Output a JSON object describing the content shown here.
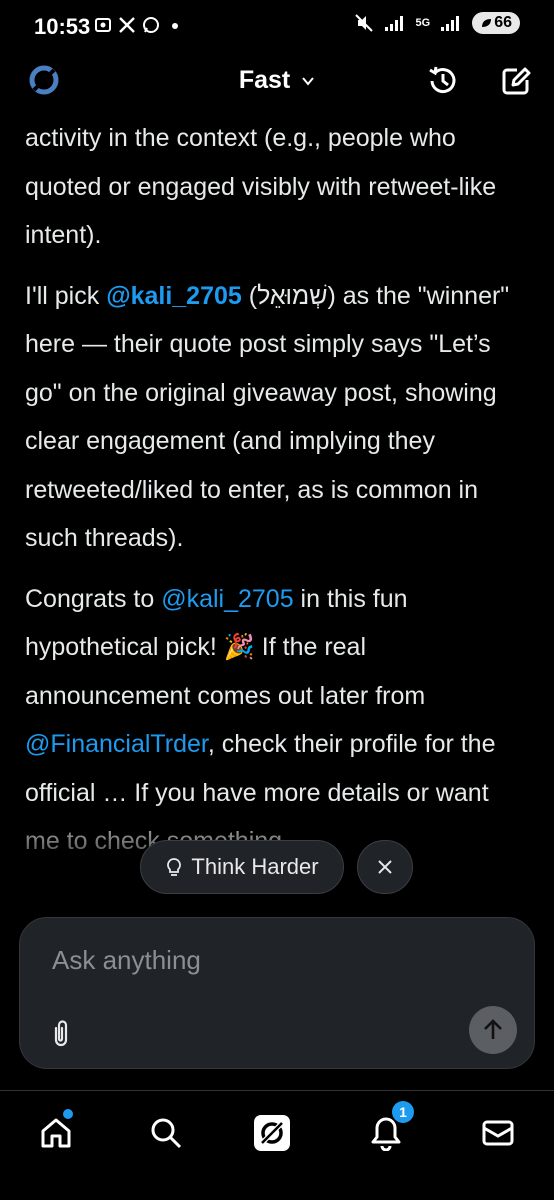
{
  "status_bar": {
    "time": "10:53",
    "network": "5G",
    "battery": "66"
  },
  "header": {
    "model_label": "Fast"
  },
  "messages": {
    "p1": "activity in the context (e.g., people who quoted or engaged visibly with retweet-like intent).",
    "p2": {
      "part1": "I'll pick ",
      "mention": "@kali_2705",
      "part2": " (שְׁמוּאֵל) as the \"winner\" here — their quote post simply says \"Let’s go\" on the original giveaway post, showing clear engagement (and implying they retweeted/liked to enter, as is common in such threads)."
    },
    "p3": {
      "part1": "Congrats to ",
      "mention1": "@kali_2705",
      "part2": " in this fun hypothetical pick! 🎉 If the real announcement comes out later from ",
      "mention2": "@FinancialTrder",
      "part3": ", check their profile for the official … If you have more details or want me to check something"
    }
  },
  "think_harder": {
    "label": "Think Harder"
  },
  "composer": {
    "placeholder": "Ask anything"
  },
  "nav": {
    "notifications_count": "1"
  }
}
